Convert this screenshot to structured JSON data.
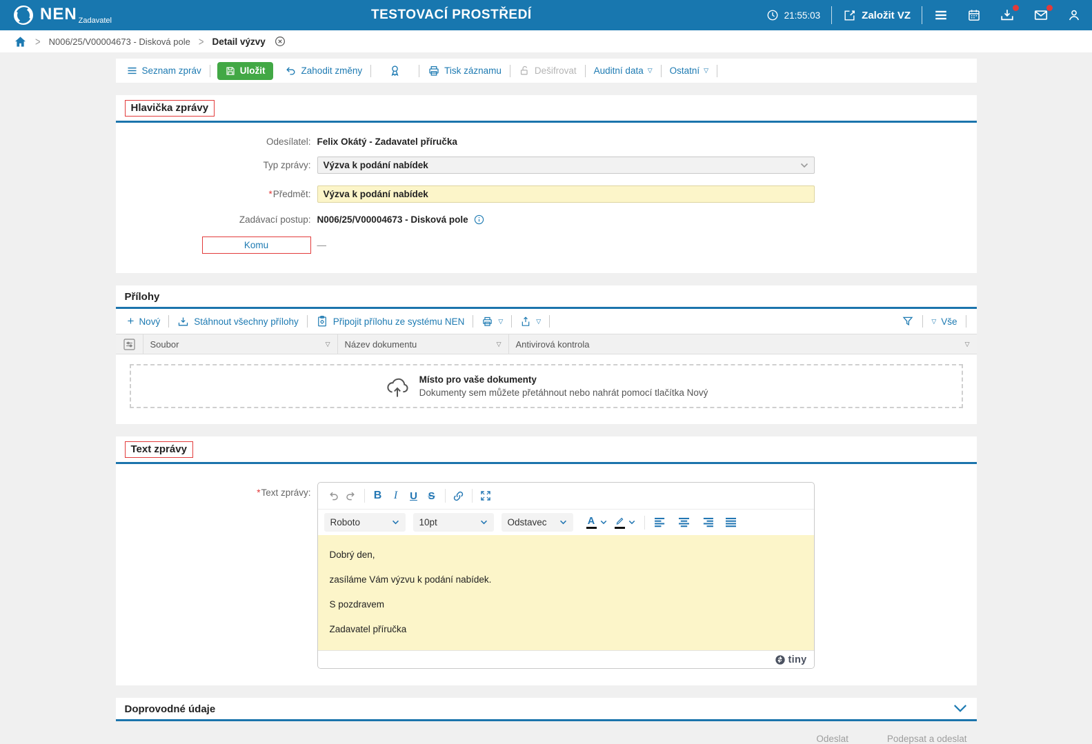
{
  "colors": {
    "header_blue": "#1877AF",
    "link_blue": "#1D7AB2",
    "save_green": "#42A845",
    "required_red": "#E23A3A",
    "field_yellow": "#FCF5C9",
    "section_border_blue": "#1B74AC"
  },
  "header": {
    "logo": "NEN",
    "logo_subtitle": "Zadavatel",
    "environment": "TESTOVACÍ PROSTŘEDÍ",
    "time": "21:55:03",
    "create_label": "Založit VZ"
  },
  "breadcrumb": {
    "procedure": "N006/25/V00004673 - Disková pole",
    "current": "Detail výzvy"
  },
  "toolbar": {
    "list": "Seznam zpráv",
    "save": "Uložit",
    "discard": "Zahodit změny",
    "print": "Tisk záznamu",
    "decrypt": "Dešifrovat",
    "audit": "Auditní data",
    "other": "Ostatní"
  },
  "header_section": {
    "title": "Hlavička zprávy",
    "required_mark": "*",
    "sender_label": "Odesílatel:",
    "sender": "Felix Okátý - Zadavatel příručka",
    "type_label": "Typ zprávy:",
    "type": "Výzva k podání nabídek",
    "subject_label": "Předmět:",
    "subject": "Výzva k podání nabídek",
    "procedure_label": "Zadávací postup:",
    "procedure": "N006/25/V00004673 - Disková pole",
    "to_label": "Komu",
    "to_value": "—"
  },
  "attachments": {
    "title": "Přílohy",
    "new": "Nový",
    "download_all": "Stáhnout všechny přílohy",
    "attach_nen": "Připojit přílohu ze systému NEN",
    "all": "Vše",
    "columns": [
      "Soubor",
      "Název dokumentu",
      "Antivirová kontrola"
    ],
    "dropzone_title": "Místo pro vaše dokumenty",
    "dropzone_hint": "Dokumenty sem můžete přetáhnout nebo nahrát pomocí tlačítka Nový"
  },
  "text_section": {
    "title": "Text zprávy",
    "required_mark": "*",
    "label": "Text zprávy:",
    "editor": {
      "font": "Roboto",
      "size": "10pt",
      "block": "Odstavec",
      "brand": "tiny",
      "paragraphs": [
        "Dobrý den,",
        "zasíláme Vám výzvu k podání nabídek.",
        "S pozdravem",
        "Zadavatel příručka"
      ]
    }
  },
  "extra_section": {
    "title": "Doprovodné údaje"
  },
  "footer": {
    "send": "Odeslat",
    "sign_send": "Podepsat a odeslat"
  },
  "icons": {
    "caret": "▽",
    "plus": "+"
  }
}
